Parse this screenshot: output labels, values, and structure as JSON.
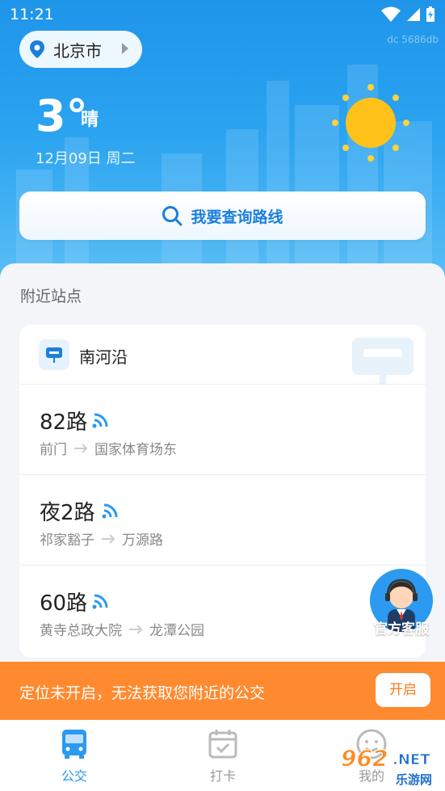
{
  "status_bar": {
    "time": "11:21"
  },
  "watermark": "dc 5686db",
  "location": {
    "city": "北京市"
  },
  "weather": {
    "temperature": "3°",
    "condition": "晴",
    "date": "12月09日  周二"
  },
  "search": {
    "label": "我要查询路线"
  },
  "nearby": {
    "title": "附近站点",
    "stop_name": "南河沿",
    "routes": [
      {
        "name": "82路",
        "from": "前门",
        "to": "国家体育场东"
      },
      {
        "name": "夜2路",
        "from": "祁家豁子",
        "to": "万源路"
      },
      {
        "name": "60路",
        "from": "黄寺总政大院",
        "to": "龙潭公园"
      }
    ]
  },
  "customer_service": {
    "label": "官方客服"
  },
  "notice": {
    "text": "定位未开启，无法获取您附近的公交",
    "button": "开启"
  },
  "tabs": [
    {
      "label": "公交",
      "icon": "bus-icon",
      "active": true
    },
    {
      "label": "打卡",
      "icon": "calendar-check-icon",
      "active": false
    },
    {
      "label": "我的",
      "icon": "user-icon",
      "active": false
    }
  ],
  "site_mark": {
    "number": "962",
    "suffix": ".NET",
    "sub": "乐游网"
  },
  "colors": {
    "primary": "#1a7fde",
    "header": "#2aa3f0",
    "orange": "#ff8a2f",
    "sun": "#ffc21a"
  }
}
